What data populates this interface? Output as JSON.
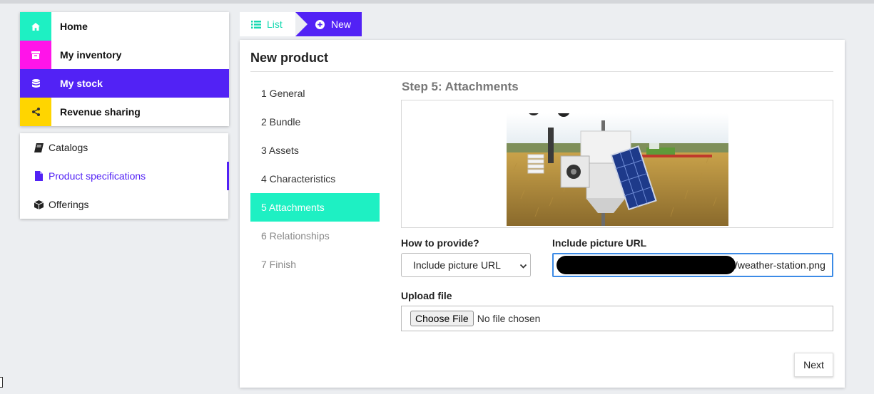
{
  "colors": {
    "home": "#1ef0c3",
    "inventory": "#ff14e9",
    "stock": "#5222f5",
    "revenue": "#ffd500",
    "accent": "#5222f5",
    "step_active": "#1ef0c3"
  },
  "main_menu": [
    {
      "label": "Home",
      "icon": "home-icon"
    },
    {
      "label": "My inventory",
      "icon": "archive-icon"
    },
    {
      "label": "My stock",
      "icon": "database-icon"
    },
    {
      "label": "Revenue sharing",
      "icon": "share-icon"
    }
  ],
  "sub_menu": [
    {
      "label": "Catalogs",
      "icon": "book-icon"
    },
    {
      "label": "Product specifications",
      "icon": "file-icon"
    },
    {
      "label": "Offerings",
      "icon": "cube-icon"
    }
  ],
  "breadcrumb": {
    "list_label": "List",
    "new_label": "New"
  },
  "panel": {
    "title": "New product"
  },
  "steps": [
    {
      "label": "1 General"
    },
    {
      "label": "2 Bundle"
    },
    {
      "label": "3 Assets"
    },
    {
      "label": "4 Characteristics"
    },
    {
      "label": "5 Attachments"
    },
    {
      "label": "6 Relationships"
    },
    {
      "label": "7 Finish"
    }
  ],
  "step_heading": "Step 5: Attachments",
  "form": {
    "how_label": "How to provide?",
    "how_value": "Include picture URL",
    "url_label": "Include picture URL",
    "url_value_visible": "/weather-station.png",
    "upload_label": "Upload file",
    "choose_file": "Choose File",
    "no_file": "No file chosen"
  },
  "next_label": "Next"
}
